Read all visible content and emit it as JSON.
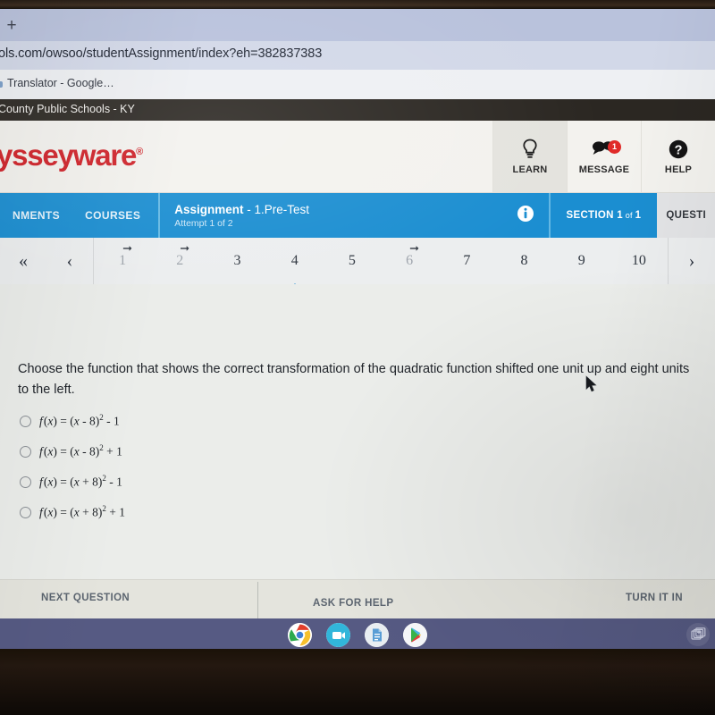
{
  "browser": {
    "new_tab_label": "+",
    "url": "ols.com/owsoo/studentAssignment/index?eh=382837383",
    "bookmark_label": "Translator - Google…",
    "window_title": "County Public Schools - KY"
  },
  "app_header": {
    "logo_text": "lysseyware",
    "logo_reg": "®",
    "logo_color": "#cf2027",
    "actions": [
      {
        "label": "LEARN",
        "icon": "lightbulb-icon",
        "badge": null
      },
      {
        "label": "MESSAGE",
        "icon": "speech-bubble-icon",
        "badge": "1"
      },
      {
        "label": "HELP",
        "icon": "question-mark-circle-icon",
        "badge": null
      }
    ]
  },
  "assignment_bar": {
    "accent_color": "#1b8ed1",
    "nav_assignments": "NMENTS",
    "nav_courses": "COURSES",
    "assignment_label": "Assignment",
    "assignment_name": "- 1.Pre-Test",
    "attempt": "Attempt 1 of 2",
    "info_icon": "info-circle-icon",
    "section_prefix": "SECTION",
    "section_number": "1",
    "section_of": "of",
    "section_total": "1",
    "question_label": "QUESTI"
  },
  "question_nav": {
    "first_arrow": "«",
    "prev_arrow": "‹",
    "next_arrow": "›",
    "current": 4,
    "items": [
      {
        "number": "1",
        "flagged": true,
        "dim": true
      },
      {
        "number": "2",
        "flagged": true,
        "dim": true
      },
      {
        "number": "3",
        "flagged": false,
        "dim": false
      },
      {
        "number": "4",
        "flagged": false,
        "dim": false
      },
      {
        "number": "5",
        "flagged": false,
        "dim": false
      },
      {
        "number": "6",
        "flagged": true,
        "dim": true
      },
      {
        "number": "7",
        "flagged": false,
        "dim": false
      },
      {
        "number": "8",
        "flagged": false,
        "dim": false
      },
      {
        "number": "9",
        "flagged": false,
        "dim": false
      },
      {
        "number": "10",
        "flagged": false,
        "dim": false
      }
    ],
    "flag_glyph": "➞"
  },
  "question": {
    "prompt": "Choose the function that shows the correct transformation of the quadratic function shifted one unit up and eight units to the left.",
    "choices": [
      {
        "id": "a",
        "text": "f (x) = (x - 8)² - 1",
        "selected": false
      },
      {
        "id": "b",
        "text": "f (x) = (x - 8)² + 1",
        "selected": false
      },
      {
        "id": "c",
        "text": "f (x) = (x + 8)² - 1",
        "selected": false
      },
      {
        "id": "d",
        "text": "f (x) = (x + 8)² + 1",
        "selected": false
      }
    ]
  },
  "action_bar": {
    "next_question": "NEXT QUESTION",
    "ask_for_help": "ASK FOR HELP",
    "turn_it_in": "TURN IT IN"
  },
  "shelf": {
    "background": "#565a83",
    "apps": [
      {
        "name": "chrome-icon",
        "active": true
      },
      {
        "name": "video-call-icon",
        "active": false
      },
      {
        "name": "google-docs-icon",
        "active": false
      },
      {
        "name": "play-store-icon",
        "active": false
      }
    ],
    "overview_icon": "window-overview-icon"
  }
}
